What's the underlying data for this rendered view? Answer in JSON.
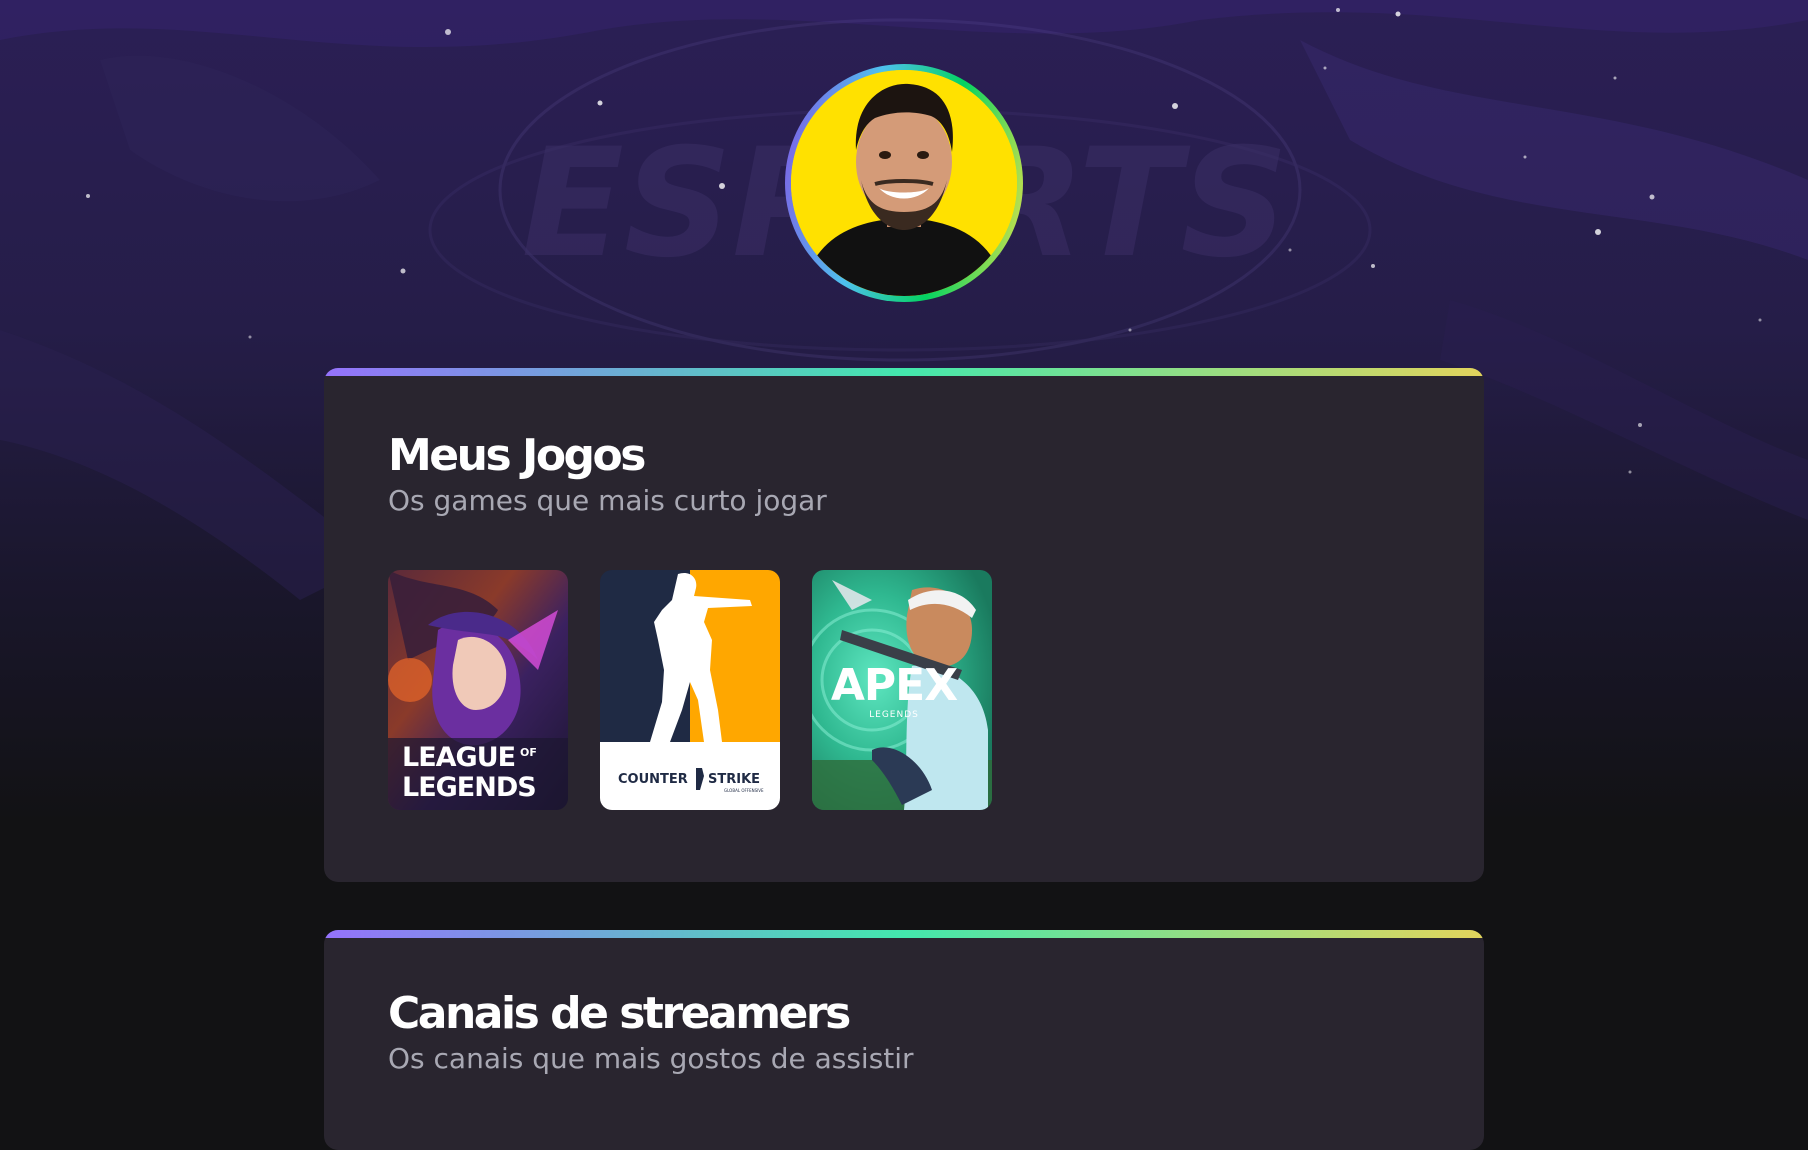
{
  "profile": {
    "avatar": "avatar-photo"
  },
  "background": {
    "watermark": "ESPORTS"
  },
  "games_section": {
    "title": "Meus Jogos",
    "subtitle": "Os games que mais curto jogar",
    "games": [
      {
        "name": "League of Legends",
        "logo_line1": "LEAGUE",
        "logo_of": "OF",
        "logo_line2": "LEGENDS"
      },
      {
        "name": "Counter-Strike: Global Offensive",
        "logo_left": "COUNTER",
        "logo_right": "STRIKE",
        "logo_sub": "GLOBAL OFFENSIVE"
      },
      {
        "name": "Apex Legends",
        "logo_main": "APEX",
        "logo_sub": "LEGENDS"
      }
    ]
  },
  "streamers_section": {
    "title": "Canais de streamers",
    "subtitle": "Os canais que mais gostos de assistir"
  },
  "colors": {
    "page_bg": "#121214",
    "card_bg": "#29252f",
    "title": "#ffffff",
    "subtitle": "#a8a8b3",
    "gradient": [
      "#9572fc",
      "#43e7ad",
      "#e2d45c"
    ]
  }
}
